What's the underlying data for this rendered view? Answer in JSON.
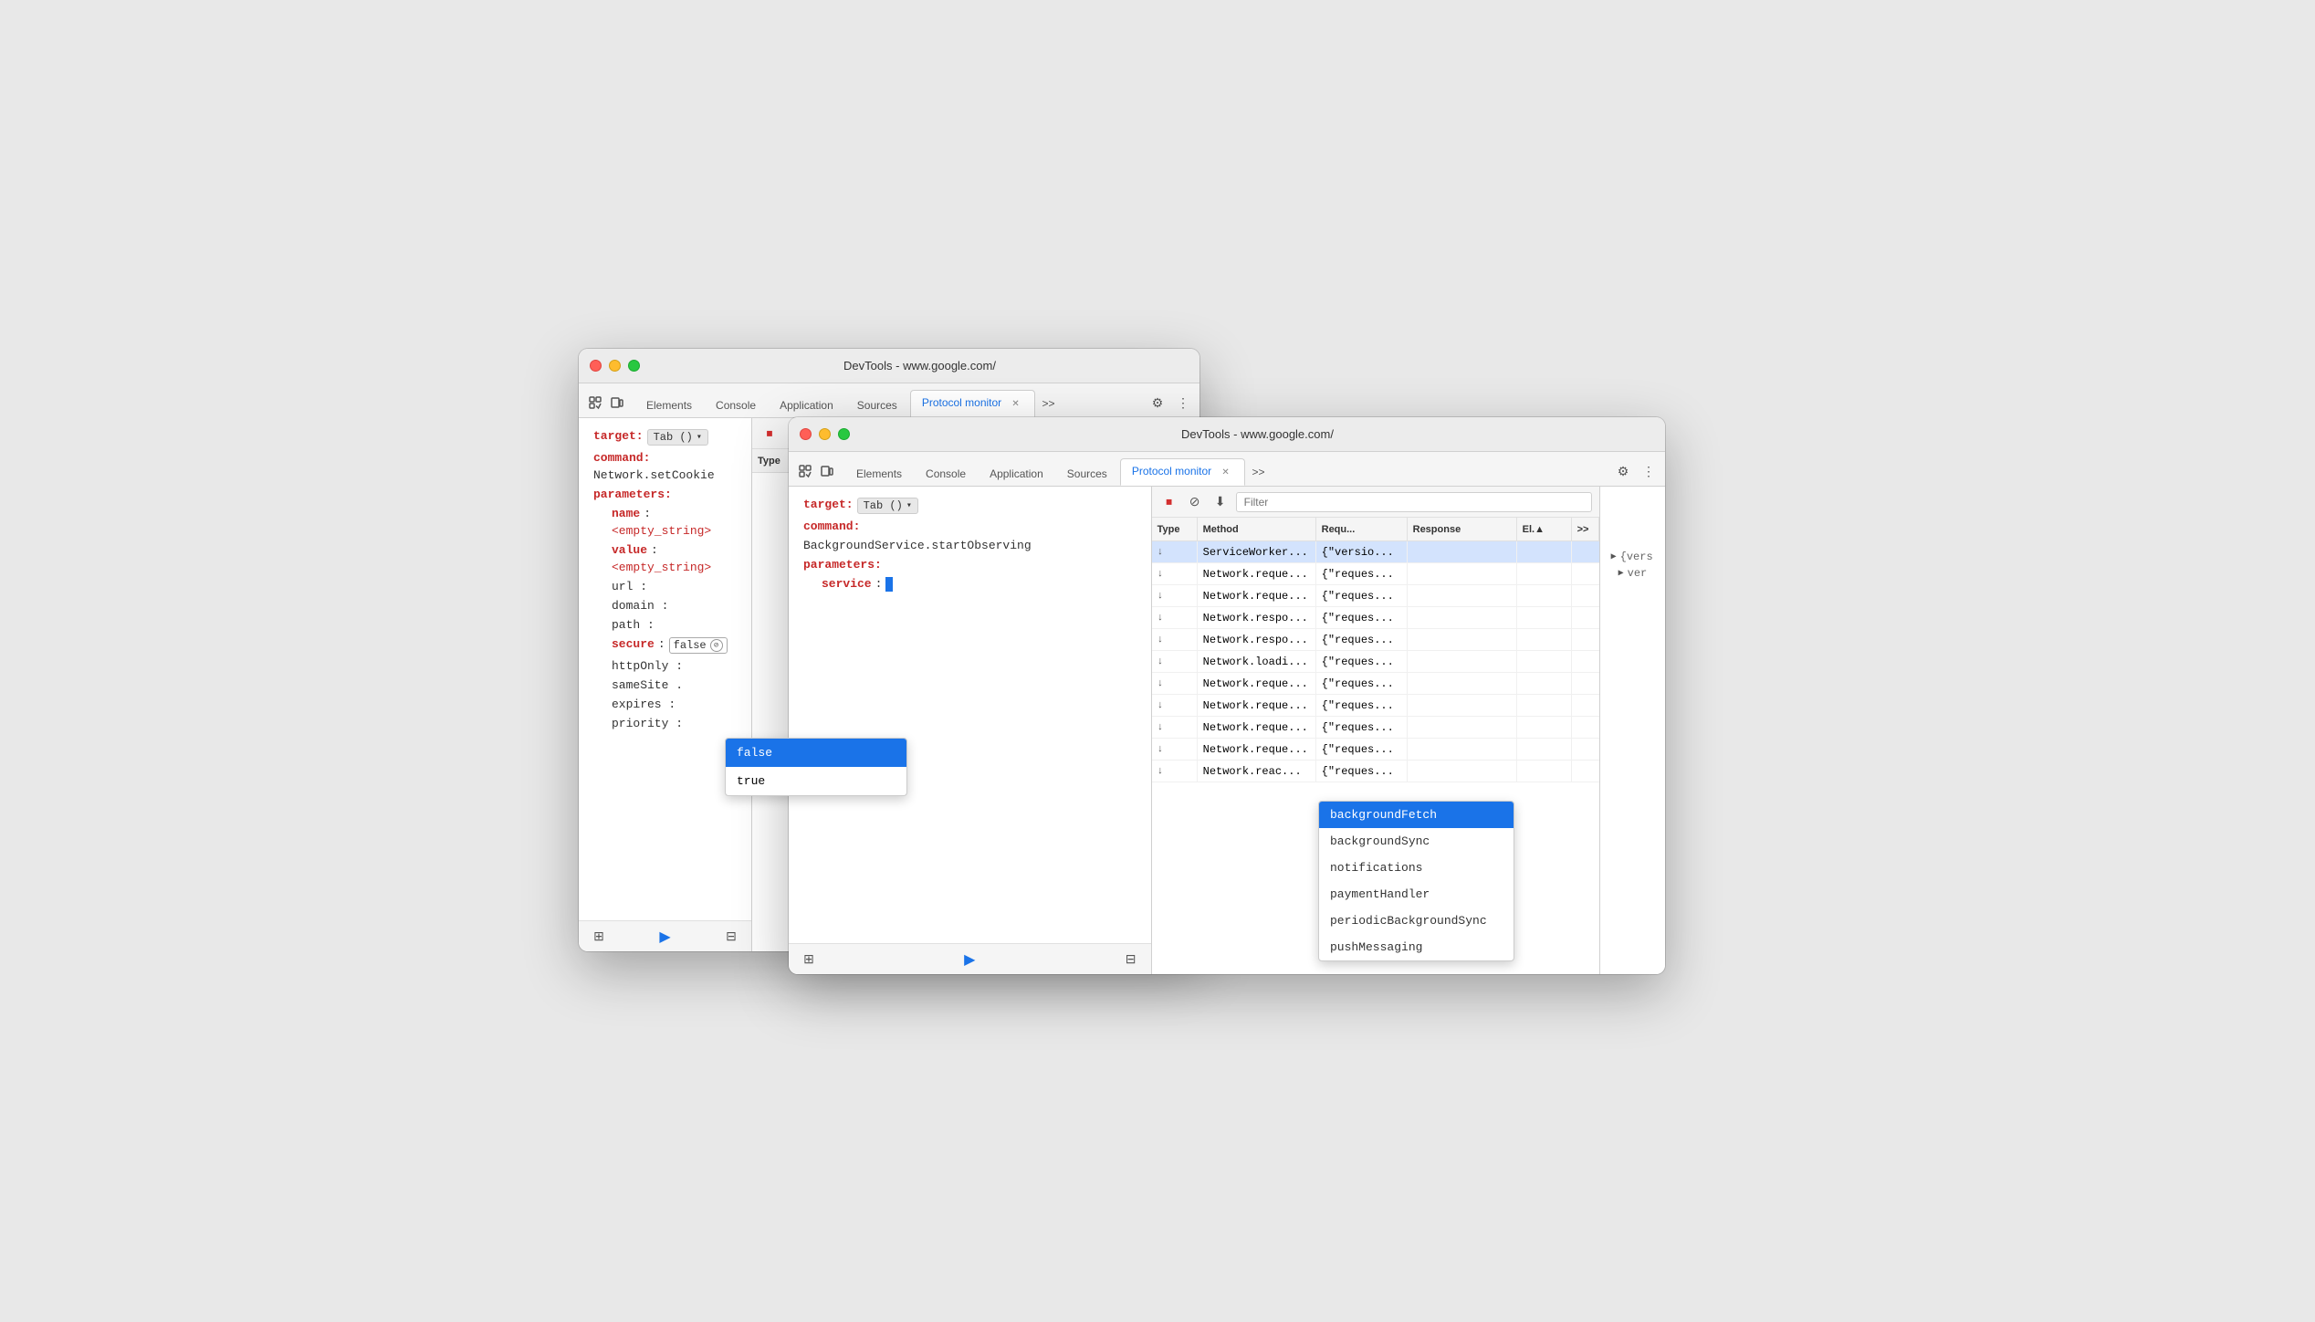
{
  "app": {
    "title_back": "DevTools - www.google.com/",
    "title_front": "DevTools - www.google.com/"
  },
  "tabs": {
    "items": [
      "Elements",
      "Console",
      "Application",
      "Sources"
    ],
    "active": "Protocol monitor",
    "active_label": "Protocol monitor"
  },
  "toolbar": {
    "filter_placeholder": "Filter",
    "stop_label": "⏹",
    "clear_label": "🚫",
    "download_label": "⬇"
  },
  "columns": {
    "type": "Type",
    "method": "Method",
    "request": "Requ...",
    "response": "Response",
    "elapsed": "El.▲",
    "more": ">>"
  },
  "back_window": {
    "command_area": {
      "target_label": "target:",
      "target_value": "Tab ()",
      "command_label": "command:",
      "command_value": "Network.setCookie",
      "parameters_label": "parameters:",
      "params": [
        {
          "key": "name",
          "value": "<empty_string>",
          "type": "param"
        },
        {
          "key": "value",
          "value": "<empty_string>",
          "type": "param"
        },
        {
          "key": "url",
          "value": "",
          "type": "empty"
        },
        {
          "key": "domain",
          "value": "",
          "type": "empty"
        },
        {
          "key": "path",
          "value": "",
          "type": "empty"
        },
        {
          "key": "secure",
          "value": "false",
          "type": "badge",
          "has_clear": true
        },
        {
          "key": "httpOnly",
          "value": "",
          "type": "empty"
        },
        {
          "key": "sameSite",
          "value": "",
          "type": "empty"
        },
        {
          "key": "expires",
          "value": "",
          "type": "empty"
        },
        {
          "key": "priority",
          "value": "",
          "type": "empty"
        }
      ]
    },
    "bool_dropdown": {
      "options": [
        "false",
        "true"
      ],
      "selected": "false"
    }
  },
  "front_window": {
    "command_area": {
      "target_label": "target:",
      "target_value": "Tab ()",
      "command_label": "command:",
      "command_value": "BackgroundService.startObserving",
      "parameters_label": "parameters:",
      "service_label": "service",
      "service_value": ""
    },
    "service_dropdown": {
      "options": [
        "backgroundFetch",
        "backgroundSync",
        "notifications",
        "paymentHandler",
        "periodicBackgroundSync",
        "pushMessaging"
      ],
      "selected": "backgroundFetch"
    },
    "table_rows": [
      {
        "arrow": "↓",
        "method": "ServiceWorker...",
        "request": "{\"versio...",
        "response": "",
        "selected": true
      },
      {
        "arrow": "↓",
        "method": "Network.reque...",
        "request": "{\"reques...",
        "response": ""
      },
      {
        "arrow": "↓",
        "method": "Network.reque...",
        "request": "{\"reques...",
        "response": ""
      },
      {
        "arrow": "↓",
        "method": "Network.respo...",
        "request": "{\"reques...",
        "response": ""
      },
      {
        "arrow": "↓",
        "method": "Network.respo...",
        "request": "{\"reques...",
        "response": ""
      },
      {
        "arrow": "↓",
        "method": "Network.loadi...",
        "request": "{\"reques...",
        "response": ""
      },
      {
        "arrow": "↓",
        "method": "Network.reque...",
        "request": "{\"reques...",
        "response": ""
      },
      {
        "arrow": "↓",
        "method": "Network.reque...",
        "request": "{\"reques...",
        "response": ""
      },
      {
        "arrow": "↓",
        "method": "Network.reque...",
        "request": "{\"reques...",
        "response": ""
      },
      {
        "arrow": "↓",
        "method": "Network.reque...",
        "request": "{\"reques...",
        "response": ""
      },
      {
        "arrow": "↓",
        "method": "Network.reac...",
        "request": "{\"reques...",
        "response": ""
      }
    ],
    "tree_view": {
      "items": [
        {
          "label": "▶ {vers",
          "indent": 0
        },
        {
          "label": "  ▶ ver",
          "indent": 1
        }
      ]
    }
  }
}
